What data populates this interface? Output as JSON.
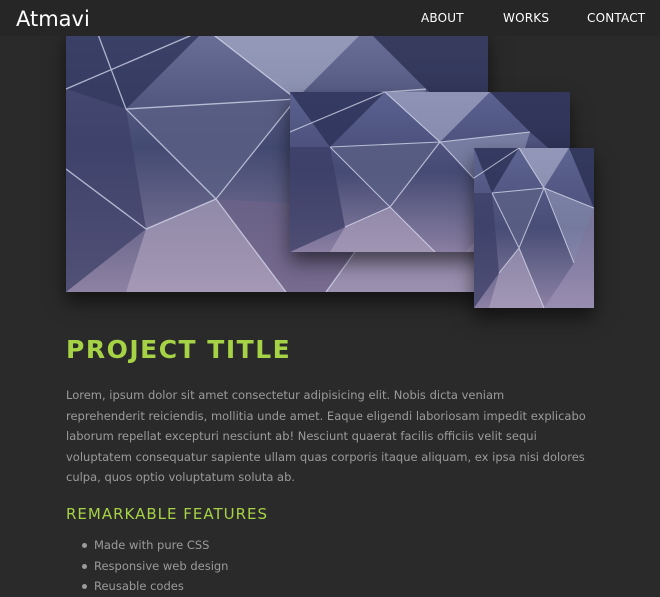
{
  "header": {
    "brand": "Atmavi",
    "nav": {
      "about": "ABOUT",
      "works": "WORKS",
      "contact": "CONTACT"
    }
  },
  "colors": {
    "background": "#2a2a2a",
    "navbar": "#262626",
    "accent": "#a6d345",
    "body_text": "#9b9b9b"
  },
  "gallery": {
    "images": [
      "crystal-geometric-image",
      "crystal-geometric-image",
      "crystal-geometric-image"
    ]
  },
  "project": {
    "title": "PROJECT TITLE",
    "description": "Lorem, ipsum dolor sit amet consectetur adipisicing elit. Nobis dicta veniam reprehenderit reiciendis, mollitia unde amet. Eaque eligendi laboriosam impedit explicabo laborum repellat excepturi nesciunt ab! Nesciunt quaerat facilis officiis velit sequi voluptatem consequatur sapiente ullam quas corporis itaque aliquam, ex ipsa nisi dolores culpa, quos optio voluptatum soluta ab."
  },
  "features": {
    "title": "REMARKABLE FEATURES",
    "items": [
      "Made with pure CSS",
      "Responsive web design",
      "Reusable codes"
    ]
  }
}
